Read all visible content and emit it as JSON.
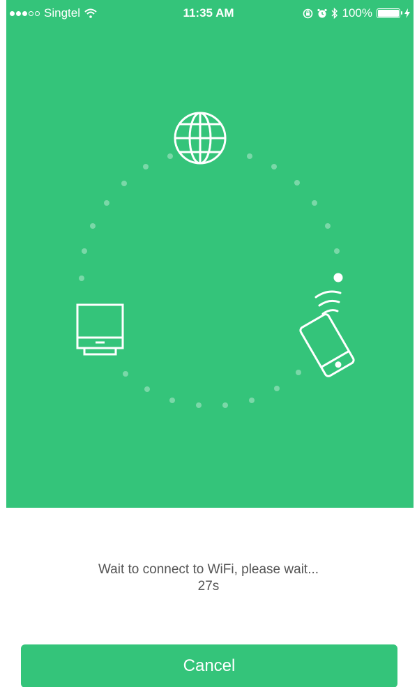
{
  "status_bar": {
    "carrier": "Singtel",
    "time": "11:35 AM",
    "battery": "100%",
    "icons": [
      "signal-dots-icon",
      "wifi-icon",
      "rotation-lock-icon",
      "alarm-icon",
      "bluetooth-icon",
      "battery-icon",
      "charging-icon"
    ]
  },
  "diagram": {
    "icons": [
      "globe-icon",
      "router-icon",
      "phone-icon",
      "wifi-signal-icon"
    ],
    "background_color": "#34c47a"
  },
  "message": {
    "text": "Wait to connect to WiFi, please wait...",
    "countdown": "27s"
  },
  "actions": {
    "cancel_label": "Cancel"
  },
  "colors": {
    "accent": "#34c47a",
    "text": "#555555"
  }
}
